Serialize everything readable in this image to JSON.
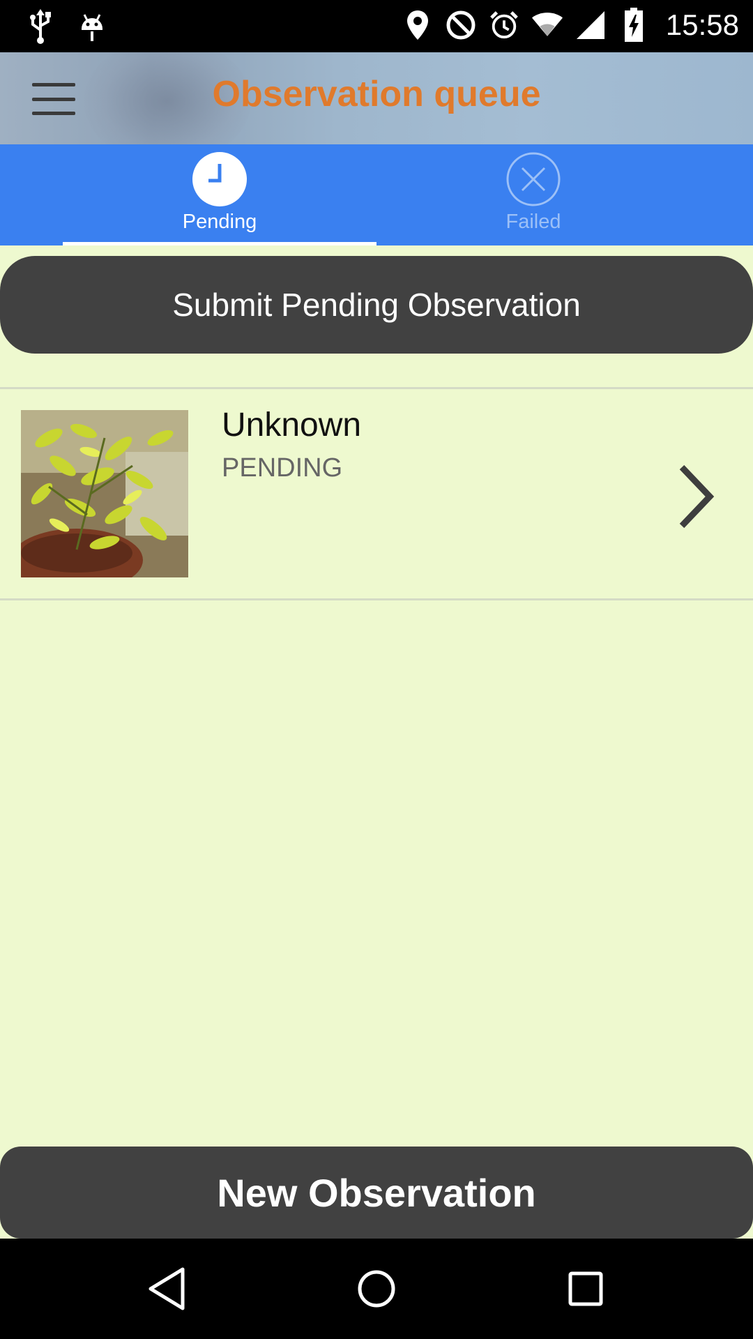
{
  "status_bar": {
    "time": "15:58",
    "left_icons": [
      "usb-icon",
      "android-debug-icon"
    ],
    "right_icons": [
      "location-icon",
      "do-not-disturb-icon",
      "alarm-icon",
      "wifi-icon",
      "cell-signal-icon",
      "battery-charging-icon"
    ]
  },
  "header": {
    "title": "Observation queue",
    "menu_icon": "hamburger-menu-icon",
    "title_color": "#e07a2c"
  },
  "tabs": [
    {
      "label": "Pending",
      "icon": "clock-icon",
      "active": true
    },
    {
      "label": "Failed",
      "icon": "close-circle-icon",
      "active": false
    }
  ],
  "actions": {
    "submit_label": "Submit Pending Observation",
    "new_label": "New Observation"
  },
  "observations": [
    {
      "title": "Unknown",
      "status": "PENDING",
      "thumbnail": "plant-photo",
      "chevron": "chevron-right-icon"
    }
  ],
  "nav_bar": {
    "buttons": [
      "back-icon",
      "home-icon",
      "recents-icon"
    ]
  },
  "colors": {
    "tab_bar": "#3a80f0",
    "background": "#eef9cf",
    "button": "#414141"
  }
}
